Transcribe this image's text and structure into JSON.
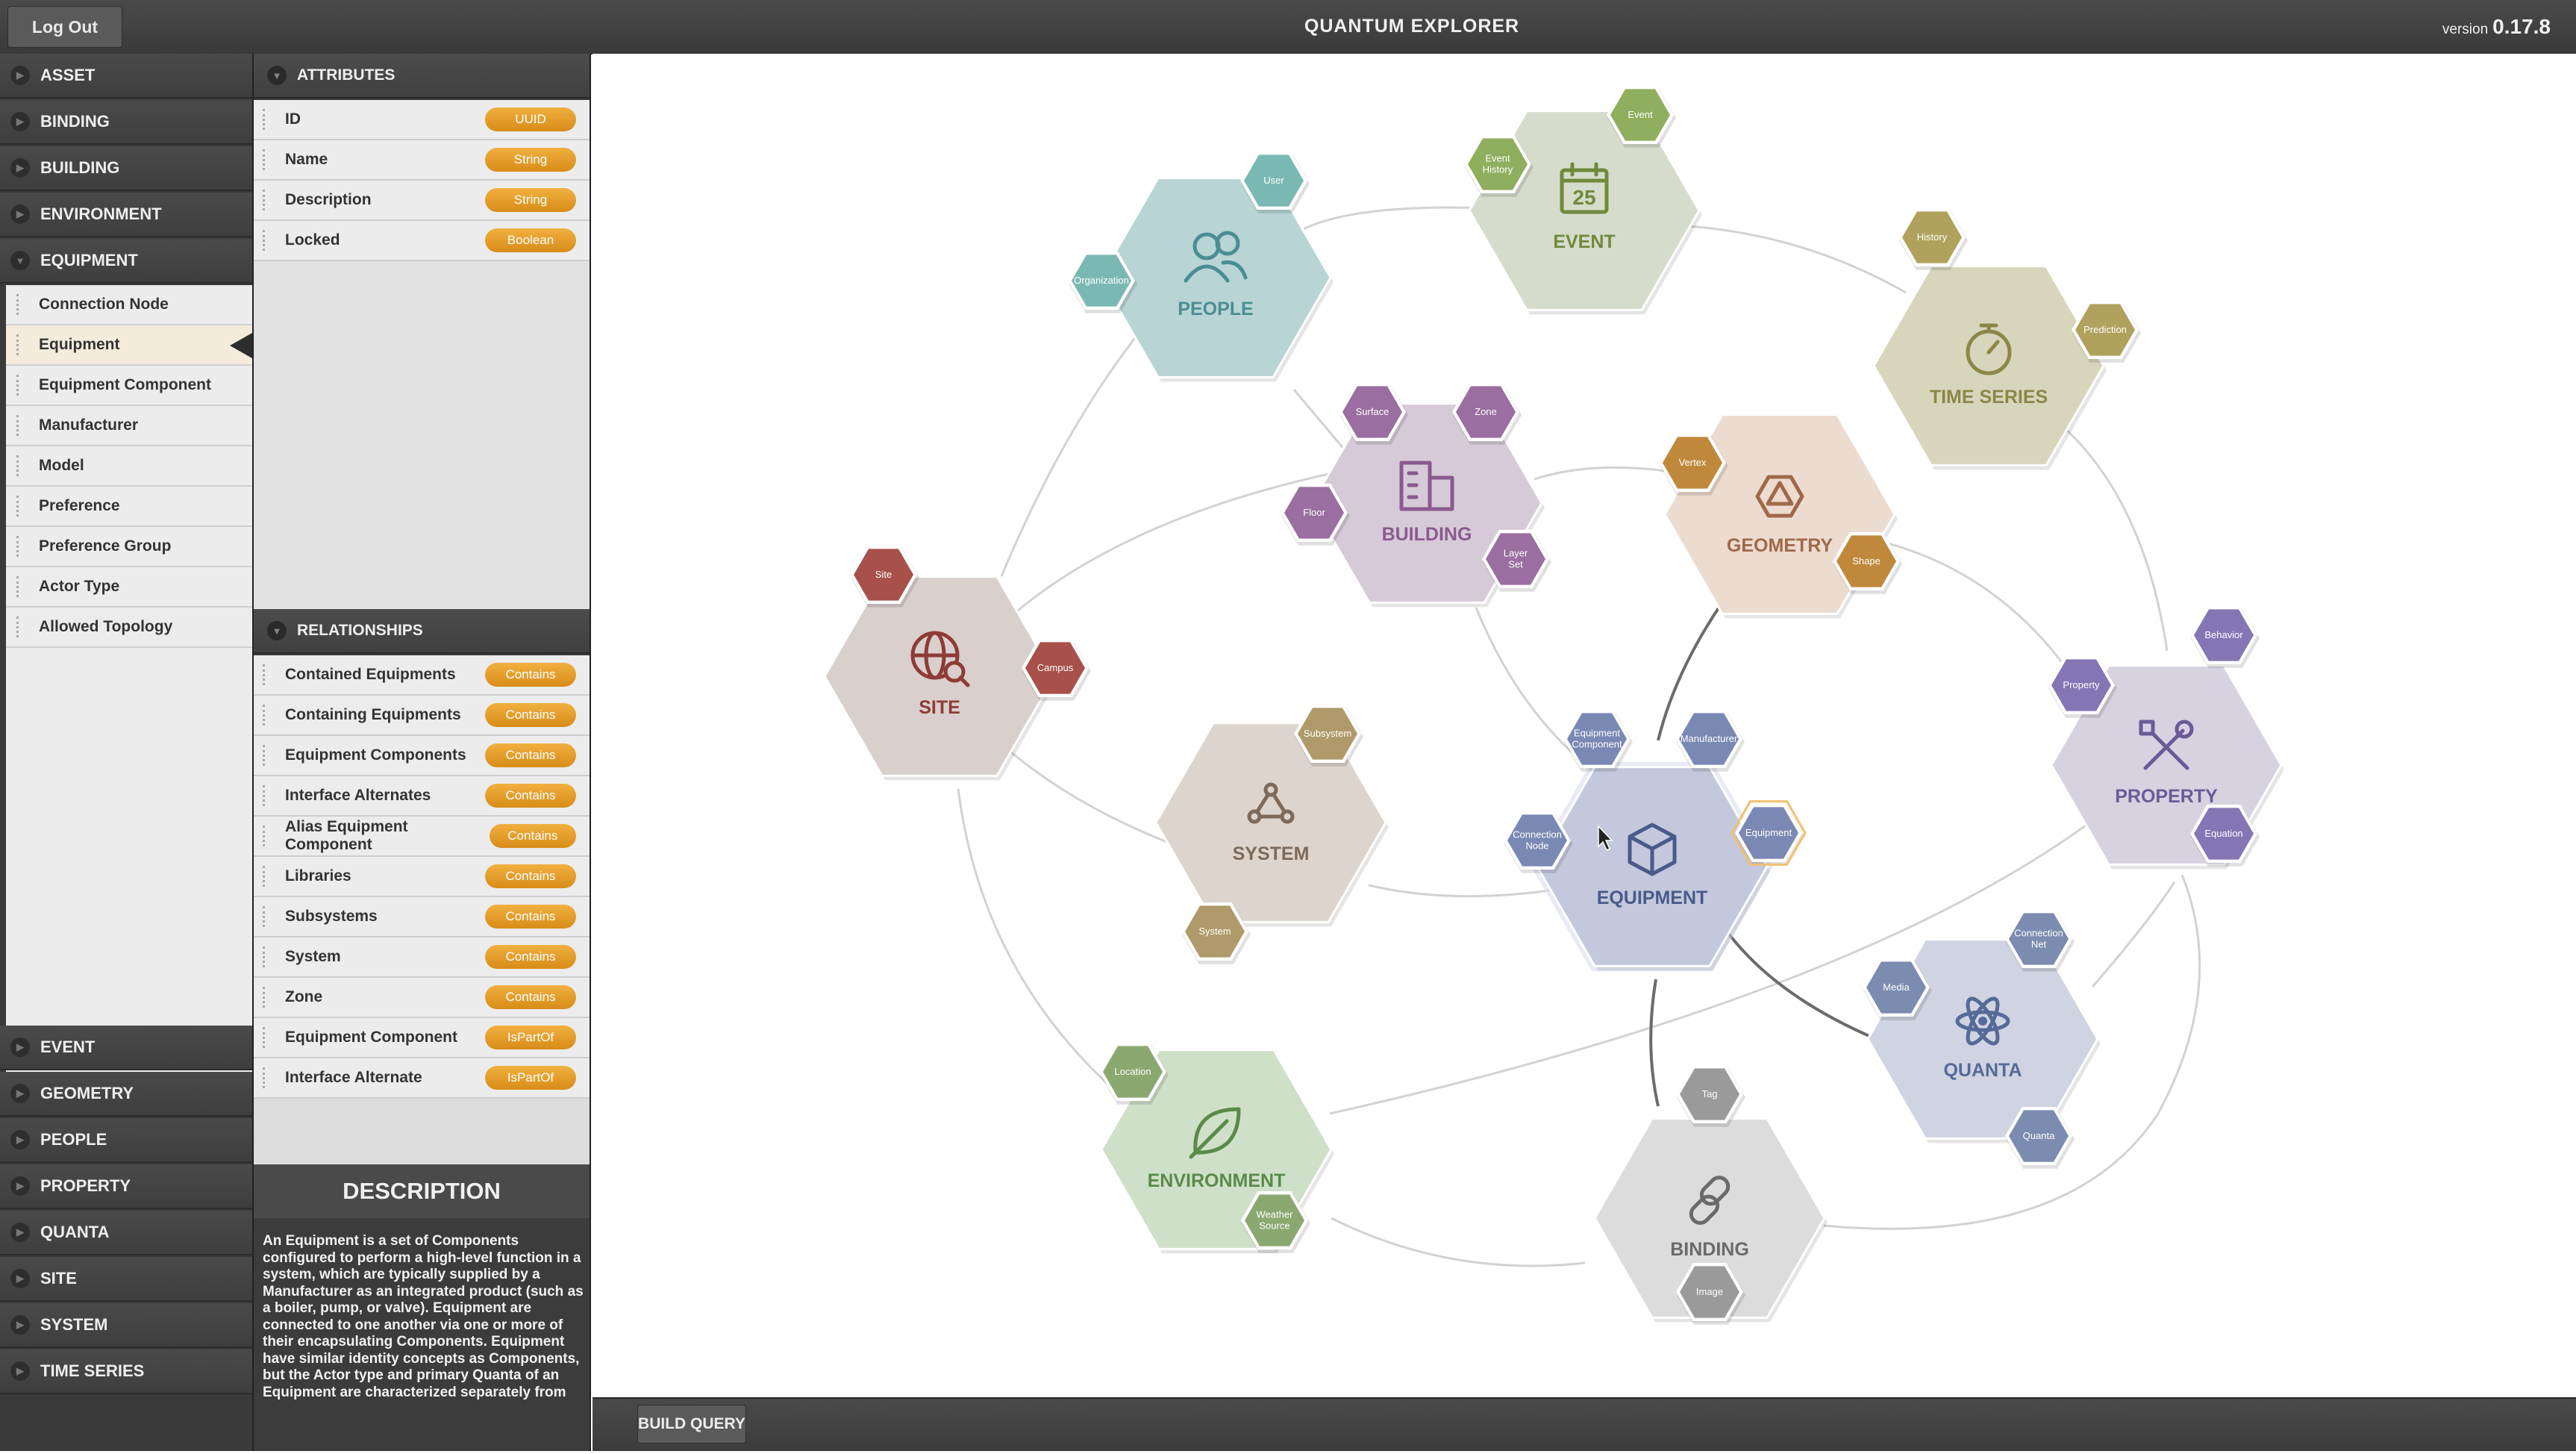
{
  "header": {
    "logout_label": "Log Out",
    "title": "QUANTUM EXPLORER",
    "version_label": "version",
    "version_number": "0.17.8"
  },
  "nav": {
    "top_sections": [
      "ASSET",
      "BINDING",
      "BUILDING",
      "ENVIRONMENT",
      "EQUIPMENT"
    ],
    "equipment_items": [
      "Connection Node",
      "Equipment",
      "Equipment Component",
      "Manufacturer",
      "Model",
      "Preference",
      "Preference Group",
      "Actor Type",
      "Allowed Topology"
    ],
    "selected_item": "Equipment",
    "bottom_sections": [
      "EVENT",
      "GEOMETRY",
      "PEOPLE",
      "PROPERTY",
      "QUANTA",
      "SITE",
      "SYSTEM",
      "TIME SERIES"
    ]
  },
  "attributes": {
    "title": "ATTRIBUTES",
    "rows": [
      {
        "name": "ID",
        "type": "UUID"
      },
      {
        "name": "Name",
        "type": "String"
      },
      {
        "name": "Description",
        "type": "String"
      },
      {
        "name": "Locked",
        "type": "Boolean"
      }
    ]
  },
  "relationships": {
    "title": "RELATIONSHIPS",
    "rows": [
      {
        "name": "Contained Equipments",
        "type": "Contains"
      },
      {
        "name": "Containing Equipments",
        "type": "Contains"
      },
      {
        "name": "Equipment Components",
        "type": "Contains"
      },
      {
        "name": "Interface Alternates",
        "type": "Contains"
      },
      {
        "name": "Alias Equipment Component",
        "type": "Contains"
      },
      {
        "name": "Libraries",
        "type": "Contains"
      },
      {
        "name": "Subsystems",
        "type": "Contains"
      },
      {
        "name": "System",
        "type": "Contains"
      },
      {
        "name": "Zone",
        "type": "Contains"
      },
      {
        "name": "Equipment Component",
        "type": "IsPartOf"
      },
      {
        "name": "Interface Alternate",
        "type": "IsPartOf"
      }
    ]
  },
  "description": {
    "title": "DESCRIPTION",
    "text": "An Equipment is a set of Components configured to perform a high-level function in a system, which are typically supplied by a Manufacturer as an integrated product (such as a boiler, pump, or valve). Equipment are connected to one another via one or more of their encapsulating Components. Equipment have similar identity concepts as Components, but the Actor type and primary Quanta of an Equipment are characterized separately from"
  },
  "footer": {
    "build_query_label": "BUILD QUERY"
  },
  "graph": {
    "nodes": [
      {
        "id": "people",
        "label": "PEOPLE",
        "icon": "people-icon",
        "fill": "#b8d4d4",
        "text": "#4a8e92"
      },
      {
        "id": "event",
        "label": "EVENT",
        "icon": "calendar-icon",
        "icon_text": "25",
        "fill": "#d6dccb",
        "text": "#6f8a3c"
      },
      {
        "id": "timeseries",
        "label": "TIME SERIES",
        "icon": "stopwatch-icon",
        "fill": "#d7d6bc",
        "text": "#8c8648"
      },
      {
        "id": "building",
        "label": "BUILDING",
        "icon": "building-icon",
        "fill": "#d7cad8",
        "text": "#8a5a8e"
      },
      {
        "id": "geometry",
        "label": "GEOMETRY",
        "icon": "polyhedron-icon",
        "fill": "#ecdbcf",
        "text": "#a0684a"
      },
      {
        "id": "site",
        "label": "SITE",
        "icon": "globe-search-icon",
        "fill": "#d9cfcd",
        "text": "#8e3b36"
      },
      {
        "id": "property",
        "label": "PROPERTY",
        "icon": "tools-icon",
        "fill": "#d6d2e0",
        "text": "#6a5a98"
      },
      {
        "id": "system",
        "label": "SYSTEM",
        "icon": "network-icon",
        "fill": "#dcd4cd",
        "text": "#7e6a5a"
      },
      {
        "id": "equipment",
        "label": "EQUIPMENT",
        "icon": "box-icon",
        "fill": "#c4c8dc",
        "text": "#4a5a8a"
      },
      {
        "id": "quanta",
        "label": "QUANTA",
        "icon": "atom-icon",
        "fill": "#cfd3e2",
        "text": "#556a96"
      },
      {
        "id": "environment",
        "label": "ENVIRONMENT",
        "icon": "leaf-icon",
        "fill": "#cfe0c8",
        "text": "#5a8a4a"
      },
      {
        "id": "binding",
        "label": "BINDING",
        "icon": "link-icon",
        "fill": "#dcdcdc",
        "text": "#6a6a6a"
      }
    ],
    "satellites": [
      {
        "label": "User",
        "fill": "#7ab9b3"
      },
      {
        "label": "Organization",
        "fill": "#7ab9b3"
      },
      {
        "label": "Event",
        "fill": "#8fae5e"
      },
      {
        "label": "Event History",
        "fill": "#8fae5e"
      },
      {
        "label": "History",
        "fill": "#b0a25c"
      },
      {
        "label": "Prediction",
        "fill": "#b0a25c"
      },
      {
        "label": "Surface",
        "fill": "#9a6ea0"
      },
      {
        "label": "Zone",
        "fill": "#9a6ea0"
      },
      {
        "label": "Floor",
        "fill": "#9a6ea0"
      },
      {
        "label": "Layer Set",
        "fill": "#9a6ea0"
      },
      {
        "label": "Vertex",
        "fill": "#c0883a"
      },
      {
        "label": "Shape",
        "fill": "#c0883a"
      },
      {
        "label": "Site",
        "fill": "#a8504a"
      },
      {
        "label": "Campus",
        "fill": "#a8504a"
      },
      {
        "label": "Property",
        "fill": "#8476b4"
      },
      {
        "label": "Behavior",
        "fill": "#8476b4"
      },
      {
        "label": "Equation",
        "fill": "#8476b4"
      },
      {
        "label": "Subsystem",
        "fill": "#b09a6a"
      },
      {
        "label": "System",
        "fill": "#b09a6a"
      },
      {
        "label": "Equipment Component",
        "fill": "#7a88b4"
      },
      {
        "label": "Manufacturer",
        "fill": "#7a88b4"
      },
      {
        "label": "Connection Node",
        "fill": "#7a88b4"
      },
      {
        "label": "Equipment",
        "fill": "#7a88b4"
      },
      {
        "label": "Connection Net",
        "fill": "#7c8cb0"
      },
      {
        "label": "Media",
        "fill": "#7c8cb0"
      },
      {
        "label": "Quanta",
        "fill": "#7c8cb0"
      },
      {
        "label": "Location",
        "fill": "#8aa870"
      },
      {
        "label": "Weather Source",
        "fill": "#8aa870"
      },
      {
        "label": "Tag",
        "fill": "#9a9a9a"
      },
      {
        "label": "Image",
        "fill": "#9a9a9a"
      }
    ]
  }
}
